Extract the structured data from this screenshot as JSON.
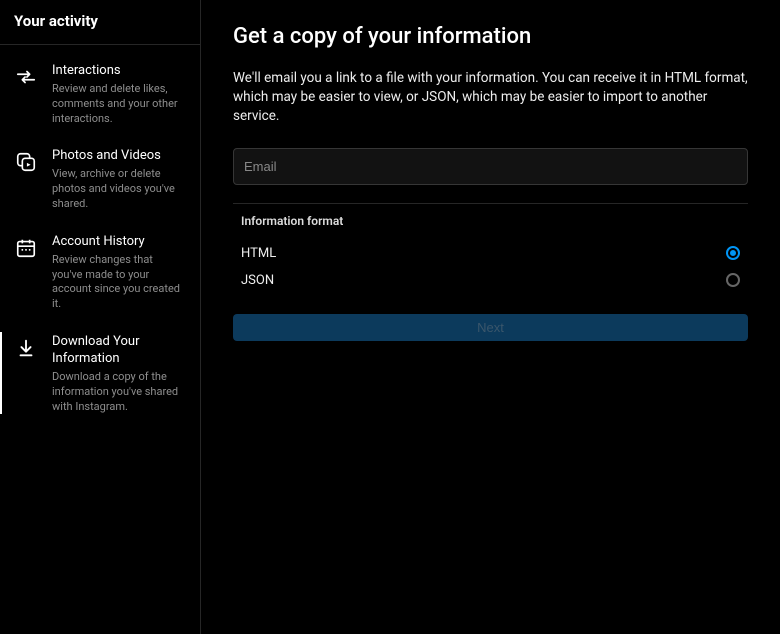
{
  "sidebar": {
    "title": "Your activity",
    "items": [
      {
        "title": "Interactions",
        "desc": "Review and delete likes, comments and your other interactions."
      },
      {
        "title": "Photos and Videos",
        "desc": "View, archive or delete photos and videos you've shared."
      },
      {
        "title": "Account History",
        "desc": "Review changes that you've made to your account since you created it."
      },
      {
        "title": "Download Your Information",
        "desc": "Download a copy of the information you've shared with Instagram."
      }
    ]
  },
  "main": {
    "title": "Get a copy of your information",
    "desc": "We'll email you a link to a file with your information. You can receive it in HTML format, which may be easier to view, or JSON, which may be easier to import to another service.",
    "email_placeholder": "Email",
    "format_label": "Information format",
    "options": [
      {
        "label": "HTML",
        "selected": true
      },
      {
        "label": "JSON",
        "selected": false
      }
    ],
    "next_label": "Next"
  }
}
